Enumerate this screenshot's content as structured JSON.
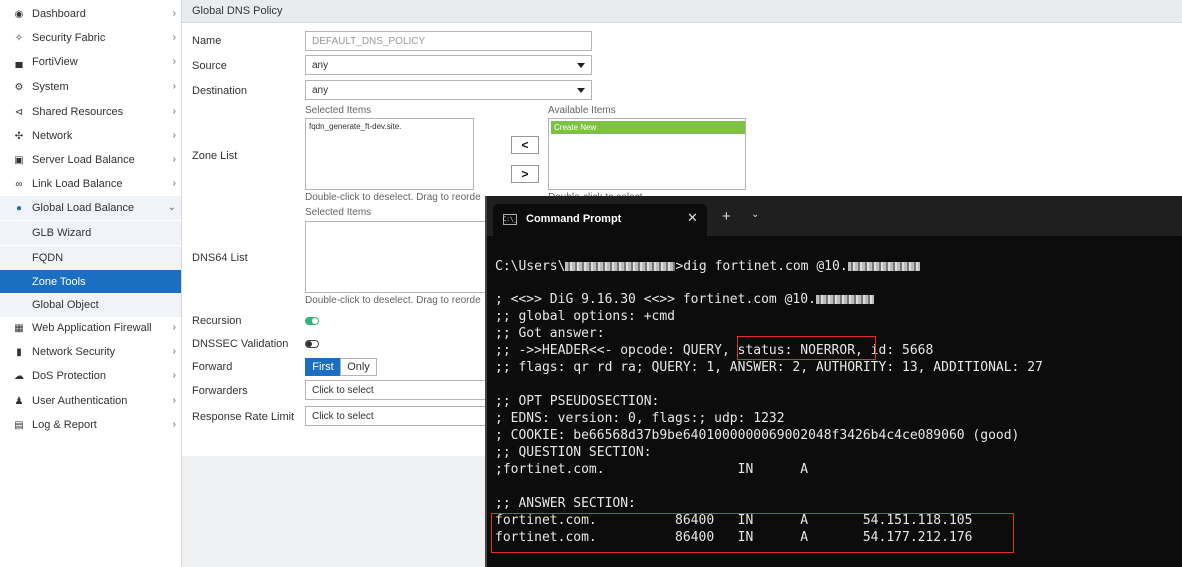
{
  "sidebar": {
    "items": [
      {
        "label": "Dashboard",
        "icon": "dashboard-icon",
        "chevron": true
      },
      {
        "label": "Security Fabric",
        "icon": "security-fabric-icon",
        "chevron": true
      },
      {
        "label": "FortiView",
        "icon": "fortiview-icon",
        "chevron": true
      },
      {
        "label": "System",
        "icon": "gear-icon",
        "chevron": true
      },
      {
        "label": "Shared Resources",
        "icon": "share-icon",
        "chevron": true
      },
      {
        "label": "Network",
        "icon": "network-icon",
        "chevron": true
      },
      {
        "label": "Server Load Balance",
        "icon": "server-icon",
        "chevron": true
      },
      {
        "label": "Link Load Balance",
        "icon": "link-icon",
        "chevron": true
      },
      {
        "label": "Global Load Balance",
        "icon": "globe-icon",
        "chevron": true,
        "expanded": true
      },
      {
        "label": "GLB Wizard",
        "sub": true
      },
      {
        "label": "FQDN",
        "sub": true
      },
      {
        "label": "Zone Tools",
        "sub": true,
        "selected": true
      },
      {
        "label": "Global Object",
        "sub": true
      },
      {
        "label": "Web Application Firewall",
        "icon": "waf-icon",
        "chevron": true
      },
      {
        "label": "Network Security",
        "icon": "shield-icon",
        "chevron": true
      },
      {
        "label": "DoS Protection",
        "icon": "cloud-icon",
        "chevron": true
      },
      {
        "label": "User Authentication",
        "icon": "user-icon",
        "chevron": true
      },
      {
        "label": "Log & Report",
        "icon": "chart-icon",
        "chevron": true
      }
    ]
  },
  "page": {
    "title": "Global DNS Policy"
  },
  "form": {
    "name_label": "Name",
    "name_value": "DEFAULT_DNS_POLICY",
    "source_label": "Source",
    "source_value": "any",
    "destination_label": "Destination",
    "destination_value": "any",
    "zone_list_label": "Zone List",
    "selected_items_label": "Selected Items",
    "available_items_label": "Available Items",
    "zone_selected_entry": "fqdn_generate_ft-dev.site.",
    "create_new_label": "Create New",
    "move_left_glyph": "<",
    "move_right_glyph": ">",
    "deselect_hint": "Double-click to deselect. Drag to reorde",
    "select_hint": "Double-click to select",
    "dns64_label": "DNS64 List",
    "dns64_selected_label": "Selected Items",
    "dns64_hint": "Double-click to deselect. Drag to reorde",
    "recursion_label": "Recursion",
    "recursion_on": true,
    "dnssec_label": "DNSSEC Validation",
    "dnssec_on": false,
    "forward_label": "Forward",
    "forward_first": "First",
    "forward_only": "Only",
    "forwarders_label": "Forwarders",
    "forwarders_placeholder": "Click to select",
    "rrl_label": "Response Rate Limit",
    "rrl_placeholder": "Click to select"
  },
  "terminal": {
    "tab_title": "Command Prompt",
    "tab_icon_text": "C:\\_",
    "close_glyph": "✕",
    "new_tab_glyph": "+",
    "dropdown_glyph": "⌄",
    "lines": [
      {
        "pre": "C:\\Users\\",
        "redact": true,
        "post": ">dig fortinet.com @10.",
        "redact2": true
      },
      {
        "pre": "",
        "post": ""
      },
      {
        "pre": "; <<>> DiG 9.16.30 <<>> fortinet.com @10.",
        "redact2": true
      },
      {
        "pre": ";; global options: +cmd"
      },
      {
        "pre": ";; Got answer:"
      },
      {
        "pre": ";; ->>HEADER<<- opcode: QUERY, status: NOERROR, id: 5668"
      },
      {
        "pre": ";; flags: qr rd ra; QUERY: 1, ANSWER: 2, AUTHORITY: 13, ADDITIONAL: 27"
      },
      {
        "pre": ""
      },
      {
        "pre": ";; OPT PSEUDOSECTION:"
      },
      {
        "pre": "; EDNS: version: 0, flags:; udp: 1232"
      },
      {
        "pre": "; COOKIE: be66568d37b9be6401000000069002048f3426b4c4ce089060 (good)"
      },
      {
        "pre": ";; QUESTION SECTION:"
      },
      {
        "pre": ";fortinet.com.                 IN      A"
      },
      {
        "pre": ""
      },
      {
        "pre": ";; ANSWER SECTION:"
      },
      {
        "pre": "fortinet.com.          86400   IN      A       54.151.118.105"
      },
      {
        "pre": "fortinet.com.          86400   IN      A       54.177.212.176"
      }
    ]
  }
}
